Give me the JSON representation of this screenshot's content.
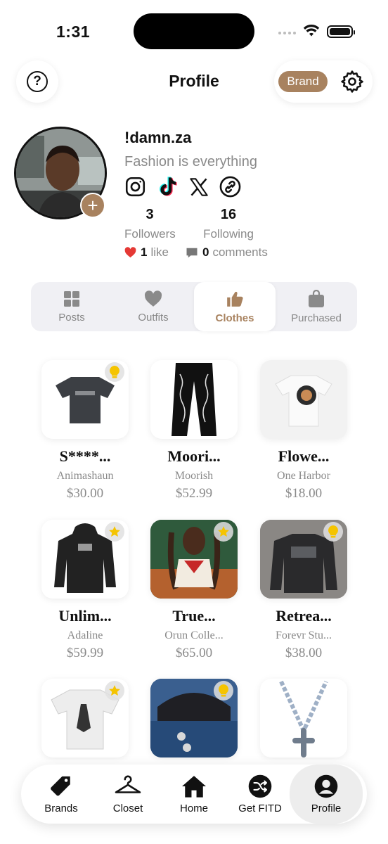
{
  "status_bar": {
    "time": "1:31"
  },
  "header": {
    "title": "Profile",
    "brand_button": "Brand"
  },
  "profile": {
    "username": "!damn.za",
    "bio": "Fashion is everything",
    "followers_count": "3",
    "followers_label": "Followers",
    "following_count": "16",
    "following_label": "Following",
    "likes_count": "1",
    "likes_label": "like",
    "comments_count": "0",
    "comments_label": "comments",
    "socials": [
      "instagram-icon",
      "tiktok-icon",
      "x-icon",
      "link-icon"
    ]
  },
  "tabs": [
    {
      "label": "Posts"
    },
    {
      "label": "Outfits"
    },
    {
      "label": "Clothes",
      "active": true
    },
    {
      "label": "Purchased"
    }
  ],
  "items": [
    {
      "name": "S****...",
      "brand": "Animashaun",
      "price": "$30.00",
      "badge": "lightbulb"
    },
    {
      "name": "Moori...",
      "brand": "Moorish",
      "price": "$52.99",
      "badge": ""
    },
    {
      "name": "Flowe...",
      "brand": "One Harbor",
      "price": "$18.00",
      "badge": ""
    },
    {
      "name": "Unlim...",
      "brand": "Adaline",
      "price": "$59.99",
      "badge": "star"
    },
    {
      "name": "True...",
      "brand": "Orun Colle...",
      "price": "$65.00",
      "badge": "star"
    },
    {
      "name": "Retrea...",
      "brand": "Forevr Stu...",
      "price": "$38.00",
      "badge": "lightbulb"
    },
    {
      "badge": "star"
    },
    {
      "badge": "lightbulb"
    },
    {
      "badge": ""
    }
  ],
  "bottom_nav": [
    {
      "label": "Brands"
    },
    {
      "label": "Closet"
    },
    {
      "label": "Home"
    },
    {
      "label": "Get FITD"
    },
    {
      "label": "Profile",
      "active": true
    }
  ],
  "colors": {
    "accent": "#a8825f",
    "star": "#f5c400",
    "heart": "#e53935"
  }
}
